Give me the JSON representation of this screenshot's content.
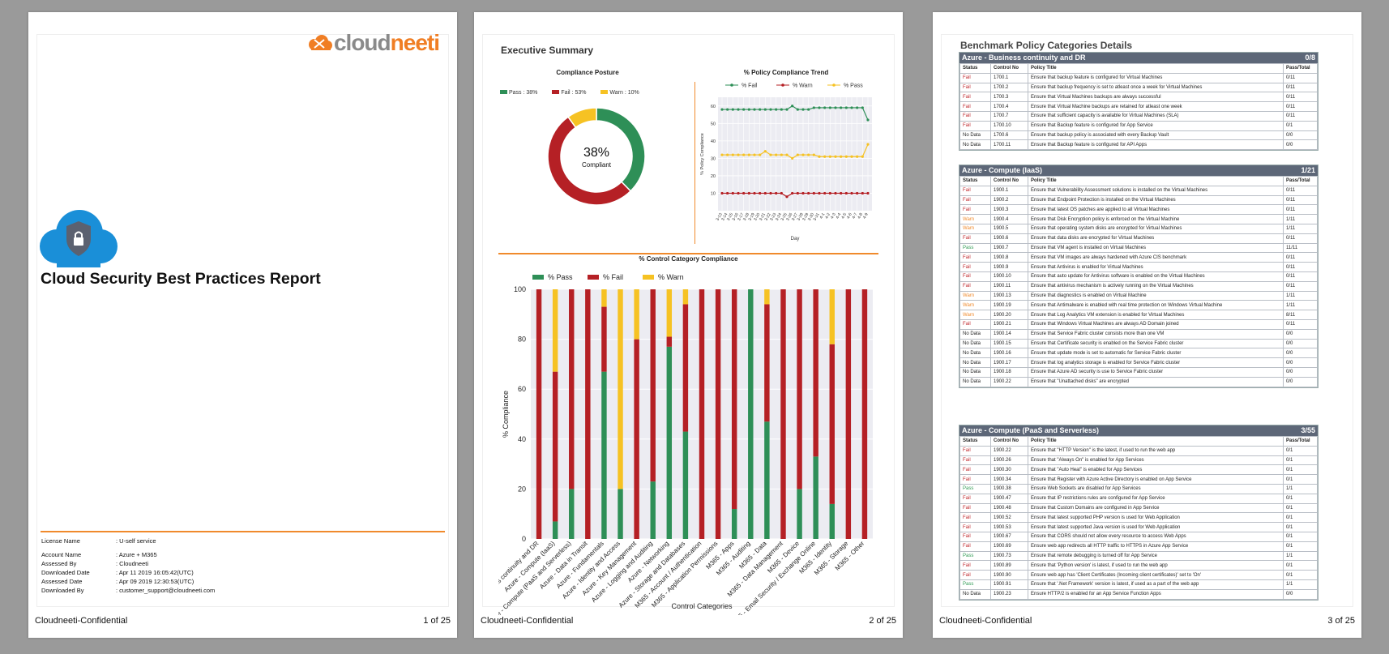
{
  "colors": {
    "pass": "#2e8f57",
    "fail": "#b52025",
    "warn": "#f6c223",
    "accent": "#f08a2c",
    "header": "#5d6778"
  },
  "footer": {
    "label": "Cloudneeti-Confidential",
    "pages": [
      "1 of 25",
      "2 of 25",
      "3 of 25"
    ]
  },
  "cover": {
    "logo": {
      "part1": "cloud",
      "part2": "neeti"
    },
    "icon": "cloud-lock-icon",
    "title": "Cloud Security Best Practices Report",
    "license": {
      "label": "License Name",
      "value": ": U-self service"
    },
    "meta": [
      {
        "label": "Account Name",
        "value": ": Azure + M365"
      },
      {
        "label": "Assessed By",
        "value": ": Cloudneeti"
      },
      {
        "label": "Downloaded Date",
        "value": ": Apr 11 2019 16:05:42(UTC)"
      },
      {
        "label": "Assessed Date",
        "value": ": Apr 09 2019 12:30:53(UTC)"
      },
      {
        "label": "Downloaded By",
        "value": ": customer_support@cloudneeti.com"
      }
    ]
  },
  "summary": {
    "heading": "Executive Summary"
  },
  "chart_data": [
    {
      "type": "pie",
      "title": "Compliance Posture",
      "categories": [
        "Pass : 38%",
        "Fail : 53%",
        "Warn : 10%"
      ],
      "values": [
        38,
        53,
        10
      ],
      "center_value": "38%",
      "center_label": "Compliant",
      "legend": "top"
    },
    {
      "type": "line",
      "title": "% Policy Compliance Trend",
      "xlabel": "Day",
      "ylabel": "% Policy Compliance",
      "ylim": [
        0,
        65
      ],
      "yticks": [
        10,
        20,
        30,
        40,
        50,
        60
      ],
      "x": [
        "3-13",
        "3-14",
        "3-15",
        "3-16",
        "3-17",
        "3-18",
        "3-19",
        "3-20",
        "3-21",
        "3-22",
        "3-23",
        "3-24",
        "3-25",
        "3-26",
        "3-27",
        "3-28",
        "3-29",
        "3-30",
        "3-31",
        "4-1",
        "4-2",
        "4-3",
        "4-4",
        "4-5",
        "4-6",
        "4-7",
        "4-8",
        "4-9"
      ],
      "series": [
        {
          "name": "% Fail",
          "values": [
            58,
            58,
            58,
            58,
            58,
            58,
            58,
            58,
            58,
            58,
            58,
            58,
            58,
            60,
            58,
            58,
            58,
            59,
            59,
            59,
            59,
            59,
            59,
            59,
            59,
            59,
            59,
            52
          ]
        },
        {
          "name": "% Warn",
          "values": [
            10,
            10,
            10,
            10,
            10,
            10,
            10,
            10,
            10,
            10,
            10,
            10,
            8,
            10,
            10,
            10,
            10,
            10,
            10,
            10,
            10,
            10,
            10,
            10,
            10,
            10,
            10,
            10
          ]
        },
        {
          "name": "% Pass",
          "values": [
            32,
            32,
            32,
            32,
            32,
            32,
            32,
            32,
            34,
            32,
            32,
            32,
            32,
            30,
            32,
            32,
            32,
            32,
            31,
            31,
            31,
            31,
            31,
            31,
            31,
            31,
            31,
            38
          ]
        }
      ],
      "grid": true,
      "legend": "top"
    },
    {
      "type": "bar",
      "stacked": true,
      "title": "% Control Category Compliance",
      "xlabel": "Control Categories",
      "ylabel": "% Compliance",
      "ylim": [
        0,
        100
      ],
      "yticks": [
        0,
        20,
        40,
        60,
        80,
        100
      ],
      "categories": [
        "Azure - Business continuity and DR",
        "Azure - Compute (IaaS)",
        "Azure - Compute (PaaS and Serverless)",
        "Azure - Data in Transit",
        "Azure - Fundamentals",
        "Azure - Identity and Access",
        "Azure - Key Management",
        "Azure - Logging and Auditing",
        "Azure - Networking",
        "Azure - Storage and Databases",
        "M365 - Account / Authentication",
        "M365 - Application Permissions",
        "M365 - Apps",
        "M365 - Auditing",
        "M365 - Data",
        "M365 - Data Management",
        "M365 - Device",
        "M365 - Email Security / Exchange Online",
        "M365 - Identity",
        "M365 - Storage",
        "M365 - Other"
      ],
      "series": [
        {
          "name": "% Pass",
          "values": [
            0,
            7,
            20,
            0,
            67,
            20,
            0,
            23,
            77,
            43,
            0,
            0,
            12,
            100,
            47,
            0,
            20,
            33,
            14,
            0,
            0
          ]
        },
        {
          "name": "% Fail",
          "values": [
            100,
            60,
            80,
            100,
            26,
            0,
            80,
            77,
            4,
            51,
            100,
            100,
            88,
            0,
            47,
            100,
            80,
            67,
            64,
            100,
            100
          ]
        },
        {
          "name": "% Warn",
          "values": [
            0,
            33,
            0,
            0,
            7,
            80,
            20,
            0,
            19,
            6,
            0,
            0,
            0,
            0,
            6,
            0,
            0,
            0,
            22,
            0,
            0
          ]
        }
      ],
      "grid": true,
      "legend": "top-left"
    }
  ],
  "benchmark": {
    "heading": "Benchmark Policy Categories Details",
    "columns": [
      "Status",
      "Control No",
      "Policy Title",
      "Pass/Total"
    ],
    "sections": [
      {
        "title": "Azure - Business continuity and DR",
        "score": "0/8",
        "rows": [
          [
            "Fail",
            "1700.1",
            "Ensure that backup feature is configured for Virtual Machines",
            "0/11"
          ],
          [
            "Fail",
            "1700.2",
            "Ensure that backup frequency is set to atleast once a week for Virtual Machines",
            "0/11"
          ],
          [
            "Fail",
            "1700.3",
            "Ensure that Virtual Machines backups are always successful",
            "0/11"
          ],
          [
            "Fail",
            "1700.4",
            "Ensure that Virtual Machine backups are retained for atleast one week",
            "0/11"
          ],
          [
            "Fail",
            "1700.7",
            "Ensure that sufficient capacity is available for Virtual Machines (SLA)",
            "0/11"
          ],
          [
            "Fail",
            "1700.10",
            "Ensure that Backup feature is configured for App Service",
            "0/1"
          ],
          [
            "No Data",
            "1700.6",
            "Ensure that backup policy is associated with every Backup Vault",
            "0/0"
          ],
          [
            "No Data",
            "1700.11",
            "Ensure that Backup feature is configured for API Apps",
            "0/0"
          ]
        ]
      },
      {
        "title": "Azure - Compute (IaaS)",
        "score": "1/21",
        "rows": [
          [
            "Fail",
            "1900.1",
            "Ensure that Vulnerability Assessment solutions is installed on the Virtual Machines",
            "0/11"
          ],
          [
            "Fail",
            "1900.2",
            "Ensure that Endpoint Protection is installed on the Virtual Machines",
            "0/11"
          ],
          [
            "Fail",
            "1900.3",
            "Ensure that latest OS patches are applied to all Virtual Machines",
            "0/11"
          ],
          [
            "Warn",
            "1900.4",
            "Ensure that Disk Encryption policy is enforced on the Virtual Machine",
            "1/11"
          ],
          [
            "Warn",
            "1900.5",
            "Ensure that operating system disks are encrypted for Virtual Machines",
            "1/11"
          ],
          [
            "Fail",
            "1900.6",
            "Ensure that data disks are encrypted for Virtual Machines",
            "0/11"
          ],
          [
            "Pass",
            "1900.7",
            "Ensure that VM agent is installed on Virtual Machines",
            "11/11"
          ],
          [
            "Fail",
            "1900.8",
            "Ensure that VM images are always hardened with Azure CIS benchmark",
            "0/11"
          ],
          [
            "Fail",
            "1900.9",
            "Ensure that Antivirus is enabled for Virtual Machines",
            "0/11"
          ],
          [
            "Fail",
            "1900.10",
            "Ensure that auto update for Antivirus software is enabled on the  Virtual Machines",
            "0/11"
          ],
          [
            "Fail",
            "1900.11",
            "Ensure that antivirus mechanism is actively running on the Virtual Machines",
            "0/11"
          ],
          [
            "Warn",
            "1900.13",
            "Ensure that diagnostics is enabled on Virtual Machine",
            "1/11"
          ],
          [
            "Warn",
            "1900.19",
            "Ensure that Antimalware is enabled with real time protection on Windows Virtual Machine",
            "1/11"
          ],
          [
            "Warn",
            "1900.20",
            "Ensure that Log Analytics VM extension is enabled for Virtual Machines",
            "8/11"
          ],
          [
            "Fail",
            "1900.21",
            "Ensure that Windows Virtual Machines are always AD Domain joined",
            "0/11"
          ],
          [
            "No Data",
            "1900.14",
            "Ensure that Service Fabric cluster consists more than one VM",
            "0/0"
          ],
          [
            "No Data",
            "1900.15",
            "Ensure that Certificate security is enabled on the Service Fabric cluster",
            "0/0"
          ],
          [
            "No Data",
            "1900.16",
            "Ensure that update mode is set to automatic for Service Fabric cluster",
            "0/0"
          ],
          [
            "No Data",
            "1900.17",
            "Ensure that log analytics storage is enabled for Service Fabric cluster",
            "0/0"
          ],
          [
            "No Data",
            "1900.18",
            "Ensure that Azure AD security is use to Service Fabric cluster",
            "0/0"
          ],
          [
            "No Data",
            "1900.22",
            "Ensure that \"Unattached disks\" are encrypted",
            "0/0"
          ]
        ]
      },
      {
        "title": "Azure - Compute (PaaS and Serverless)",
        "score": "3/55",
        "rows": [
          [
            "Fail",
            "1900.22",
            "Ensure that \"HTTP Version\" is the latest, if used to run the web app",
            "0/1"
          ],
          [
            "Fail",
            "1900.26",
            "Ensure that \"Always On\" is enabled for App Services",
            "0/1"
          ],
          [
            "Fail",
            "1900.30",
            "Ensure that \"Auto Heal\" is enabled for App Services",
            "0/1"
          ],
          [
            "Fail",
            "1900.34",
            "Ensure that Register with Azure Active Directory is enabled on App Service",
            "0/1"
          ],
          [
            "Pass",
            "1900.38",
            "Ensure Web Sockets are disabled for App Services",
            "1/1"
          ],
          [
            "Fail",
            "1900.47",
            "Ensure that IP restrictions rules are configured for App Service",
            "0/1"
          ],
          [
            "Fail",
            "1900.48",
            "Ensure that Custom Domains are configured in App Service",
            "0/1"
          ],
          [
            "Fail",
            "1900.52",
            "Ensure that latest supported PHP version is used for Web Application",
            "0/1"
          ],
          [
            "Fail",
            "1900.53",
            "Ensure that latest supported Java version is used for Web Application",
            "0/1"
          ],
          [
            "Fail",
            "1900.67",
            "Ensure that CORS should not allow every resource to access Web Apps",
            "0/1"
          ],
          [
            "Fail",
            "1900.69",
            "Ensure web app redirects all HTTP traffic to HTTPS in Azure App Service",
            "0/1"
          ],
          [
            "Pass",
            "1900.73",
            "Ensure that remote debugging is turned off for App Service",
            "1/1"
          ],
          [
            "Fail",
            "1900.89",
            "Ensure that 'Python version' is latest, if used to run the web app",
            "0/1"
          ],
          [
            "Fail",
            "1900.90",
            "Ensure web app has 'Client Certificates (Incoming client certificates)' set to 'On'",
            "0/1"
          ],
          [
            "Pass",
            "1900.91",
            "Ensure that '.Net Framework' version is latest, if used as a part of the web app",
            "1/1"
          ],
          [
            "No Data",
            "1900.23",
            "Ensure HTTP/2 is enabled for an App Service Function Apps",
            "0/0"
          ]
        ]
      }
    ]
  }
}
